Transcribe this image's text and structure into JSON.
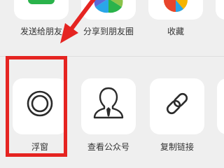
{
  "share_row": {
    "items": [
      {
        "label": "发送给朋友",
        "icon": "wechat-friend-icon",
        "color": "#2ab34b"
      },
      {
        "label": "分享到朋友圈",
        "icon": "moments-icon"
      },
      {
        "label": "收藏",
        "icon": "favorite-icon"
      },
      {
        "label": "",
        "icon": "more-icon"
      }
    ]
  },
  "action_row": {
    "items": [
      {
        "label": "浮窗",
        "icon": "float-window-icon"
      },
      {
        "label": "查看公众号",
        "icon": "official-account-icon"
      },
      {
        "label": "复制链接",
        "icon": "copy-link-icon"
      },
      {
        "label": "",
        "icon": "more-tile-icon"
      }
    ]
  },
  "annotation": {
    "color": "#e52421"
  }
}
